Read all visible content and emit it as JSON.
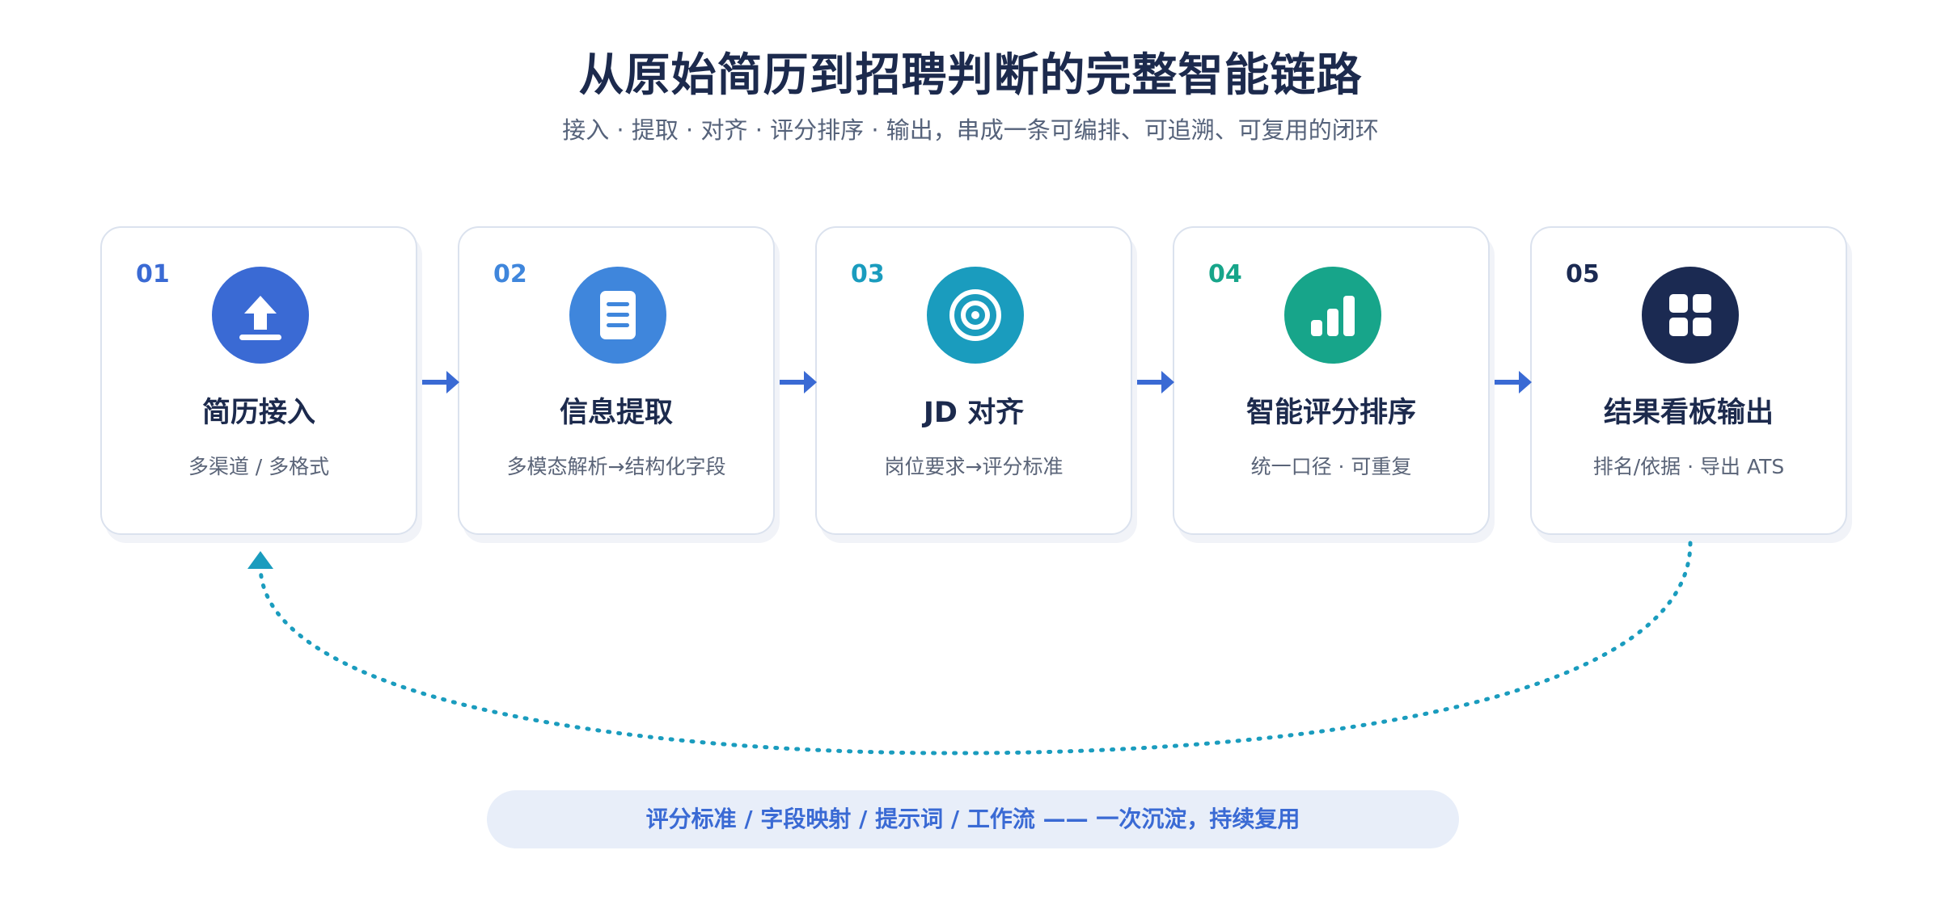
{
  "header": {
    "title": "从原始简历到招聘判断的完整智能链路",
    "subtitle": "接入 · 提取 · 对齐 · 评分排序 · 输出，串成一条可编排、可追溯、可复用的闭环"
  },
  "steps": [
    {
      "num": "01",
      "title": "简历接入",
      "desc": "多渠道 / 多格式",
      "icon": "upload-icon",
      "color": "#3a6ad4"
    },
    {
      "num": "02",
      "title": "信息提取",
      "desc": "多模态解析→结构化字段",
      "icon": "document-icon",
      "color": "#3f86dc"
    },
    {
      "num": "03",
      "title": "JD 对齐",
      "desc": "岗位要求→评分标准",
      "icon": "target-icon",
      "color": "#1a9cbe"
    },
    {
      "num": "04",
      "title": "智能评分排序",
      "desc": "统一口径 · 可重复",
      "icon": "bar-chart-icon",
      "color": "#17a58a"
    },
    {
      "num": "05",
      "title": "结果看板输出",
      "desc": "排名/依据 · 导出 ATS",
      "icon": "dashboard-icon",
      "color": "#1b2a52"
    }
  ],
  "footer": {
    "pill_text": "评分标准 / 字段映射 / 提示词 / 工作流 —— 一次沉淀，持续复用"
  },
  "colors": {
    "arrow": "#3a6ad4",
    "loop": "#1a9cbe",
    "title": "#1c2a4d"
  }
}
